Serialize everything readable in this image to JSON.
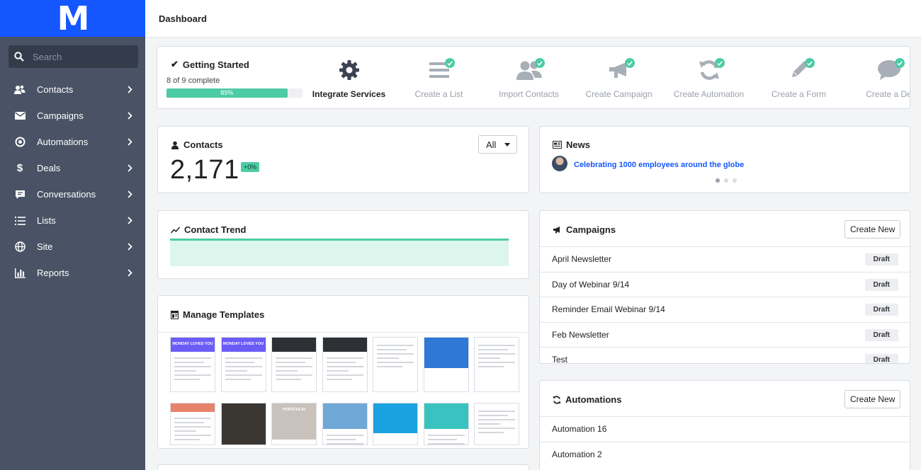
{
  "brand": {
    "logo_text": "M",
    "accent": "#1457ff",
    "sidebar_bg": "#495365",
    "success": "#4dcba4"
  },
  "search": {
    "placeholder": "Search"
  },
  "sidebar": {
    "items": [
      {
        "label": "Contacts",
        "icon": "contacts-icon"
      },
      {
        "label": "Campaigns",
        "icon": "envelope-icon"
      },
      {
        "label": "Automations",
        "icon": "automation-icon"
      },
      {
        "label": "Deals",
        "icon": "dollar-icon"
      },
      {
        "label": "Conversations",
        "icon": "chat-icon"
      },
      {
        "label": "Lists",
        "icon": "list-icon"
      },
      {
        "label": "Site",
        "icon": "globe-icon"
      },
      {
        "label": "Reports",
        "icon": "bar-chart-icon"
      }
    ]
  },
  "header": {
    "title": "Dashboard"
  },
  "getting_started": {
    "title": "Getting Started",
    "progress_text": "8 of 9 complete",
    "progress_percent": 89,
    "progress_label": "89%",
    "steps": [
      {
        "label": "Integrate Services",
        "icon": "gear-icon",
        "done": false,
        "active": true
      },
      {
        "label": "Create a List",
        "icon": "list-icon",
        "done": true,
        "active": false
      },
      {
        "label": "Import Contacts",
        "icon": "users-icon",
        "done": true,
        "active": false
      },
      {
        "label": "Create Campaign",
        "icon": "megaphone-icon",
        "done": true,
        "active": false
      },
      {
        "label": "Create Automation",
        "icon": "refresh-icon",
        "done": true,
        "active": false
      },
      {
        "label": "Create a Form",
        "icon": "pencil-icon",
        "done": true,
        "active": false
      },
      {
        "label": "Create a De",
        "icon": "speech-bubble-icon",
        "done": true,
        "active": false
      }
    ]
  },
  "contacts_card": {
    "title": "Contacts",
    "count": "2,171",
    "change": "+0%",
    "filter": "All"
  },
  "news_card": {
    "title": "News",
    "headline": "Celebrating 1000 employees around the globe",
    "slides": 3,
    "current_slide": 1
  },
  "trend_card": {
    "title": "Contact Trend"
  },
  "templates_card": {
    "title": "Manage Templates",
    "templates": [
      {
        "thumb_text": "MONDAY LOVES YOU",
        "band_color": "#6b5cf6",
        "band_height": 0.26
      },
      {
        "thumb_text": "MONDAY LOVES YOU",
        "band_color": "#6b5cf6",
        "band_height": 0.26
      },
      {
        "thumb_text": "",
        "band_color": "#2d3035",
        "band_height": 0.26
      },
      {
        "thumb_text": "",
        "band_color": "#2d3035",
        "band_height": 0.26
      },
      {
        "thumb_text": "",
        "band_color": "#ffffff",
        "band_height": 0.0
      },
      {
        "thumb_text": "",
        "band_color": "#2f78d6",
        "band_height": 0.55
      },
      {
        "thumb_text": "",
        "band_color": "#ffffff",
        "band_height": 0.0
      },
      {
        "thumb_text": "",
        "band_color": "#e8836b",
        "band_height": 0.2
      },
      {
        "thumb_text": "",
        "band_color": "#3a3632",
        "band_height": 1.0
      },
      {
        "thumb_text": "PORTFOLIO",
        "band_color": "#c9c2bc",
        "band_height": 0.85
      },
      {
        "thumb_text": "",
        "band_color": "#6fa8d6",
        "band_height": 0.6
      },
      {
        "thumb_text": "",
        "band_color": "#1aa2e0",
        "band_height": 0.7
      },
      {
        "thumb_text": "",
        "band_color": "#39c3c0",
        "band_height": 0.6
      },
      {
        "thumb_text": "",
        "band_color": "#ffffff",
        "band_height": 0.0
      }
    ]
  },
  "campaigns_card": {
    "title": "Campaigns",
    "create_label": "Create New",
    "rows": [
      {
        "name": "April Newsletter",
        "status": "Draft"
      },
      {
        "name": "Day of Webinar 9/14",
        "status": "Draft"
      },
      {
        "name": "Reminder Email Webinar 9/14",
        "status": "Draft"
      },
      {
        "name": "Feb Newsletter",
        "status": "Draft"
      },
      {
        "name": "Test",
        "status": "Draft"
      }
    ]
  },
  "automations_card": {
    "title": "Automations",
    "create_label": "Create New",
    "rows": [
      {
        "name": "Automation 16"
      },
      {
        "name": "Automation 2"
      }
    ]
  }
}
